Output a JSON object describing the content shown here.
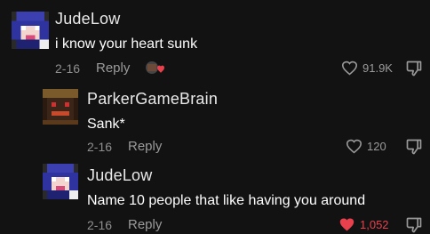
{
  "comments": [
    {
      "username": "JudeLow",
      "text": "i know your heart sunk",
      "date": "2-16",
      "reply_label": "Reply",
      "likes": "91.9K",
      "liked": false
    },
    {
      "username": "ParkerGameBrain",
      "text": "Sank*",
      "date": "2-16",
      "reply_label": "Reply",
      "likes": "120",
      "liked": false
    },
    {
      "username": "JudeLow",
      "text": "Name 10 people that like having you around",
      "date": "2-16",
      "reply_label": "Reply",
      "likes": "1,052",
      "liked": true
    }
  ],
  "colors": {
    "background": "#121212",
    "liked": "#e8414d",
    "muted": "#9a9a9a"
  },
  "icons": [
    "heart-outline-icon",
    "heart-filled-icon",
    "dislike-icon",
    "creator-reaction-icon"
  ]
}
